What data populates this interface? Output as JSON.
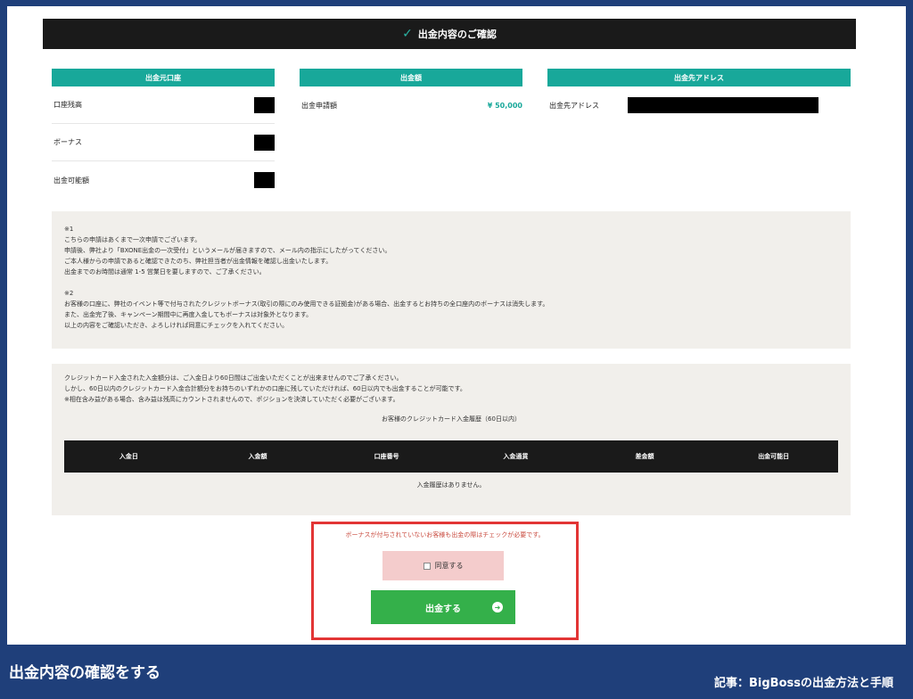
{
  "header": {
    "title": "出金内容のご確認"
  },
  "source_account": {
    "heading": "出金元口座",
    "rows": [
      {
        "label": "口座残高"
      },
      {
        "label": "ボーナス"
      },
      {
        "label": "出金可能額"
      }
    ]
  },
  "amount": {
    "heading": "出金額",
    "label": "出金申請額",
    "value": "¥ 50,000"
  },
  "destination": {
    "heading": "出金先アドレス",
    "label": "出金先アドレス"
  },
  "notes": {
    "note1_mark": "※1",
    "note1_lines": [
      "こちらの申請はあくまで一次申請でございます。",
      "申請後、弊社より「BXONE出金の一次受付」というメールが届きますので、メール内の指示にしたがってください。",
      "ご本人様からの申請であると確認できたのち、弊社担当者が出金情報を確認し出金いたします。",
      "出金までのお時間は通常 1-5 営業日を要しますので、ご了承ください。"
    ],
    "note2_mark": "※2",
    "note2_lines": [
      "お客様の口座に、弊社のイベント等で付与されたクレジットボーナス(取引の際にのみ使用できる証拠金)がある場合、出金するとお持ちの全口座内のボーナスは消失します。",
      "また、出金完了後、キャンペーン期間中に再度入金してもボーナスは対象外となります。",
      "以上の内容をご確認いただき、よろしければ同意にチェックを入れてください。"
    ]
  },
  "credit": {
    "lines": [
      "クレジットカード入金された入金額分は、ご入金日より60日間はご出金いただくことが出来ませんのでご了承ください。",
      "しかし、60日以内のクレジットカード入金合計額分をお持ちのいずれかの口座に残していただければ、60日以内でも出金することが可能です。",
      "※相在含み益がある場合、含み益は残高にカウントされませんので、ポジションを決済していただく必要がございます。"
    ],
    "table_title": "お客様のクレジットカード入金履歴（60日以内）",
    "columns": [
      "入金日",
      "入金額",
      "口座番号",
      "入金通貨",
      "差金額",
      "出金可能日"
    ],
    "empty_message": "入金履歴はありません。"
  },
  "confirm": {
    "warning": "ボーナスが付与されていないお客様も出金の際はチェックが必要です。",
    "agree_label": "同意する",
    "submit_label": "出金する"
  },
  "footer": {
    "caption": "出金内容の確認をする",
    "credit": "記事：BigBossの出金方法と手順"
  },
  "colors": {
    "background": "#1f3f7a",
    "teal": "#18a89a",
    "header": "#1a1a1a",
    "highlight": "#e23535",
    "submit": "#34b04a",
    "agree": "#f4cccc"
  }
}
